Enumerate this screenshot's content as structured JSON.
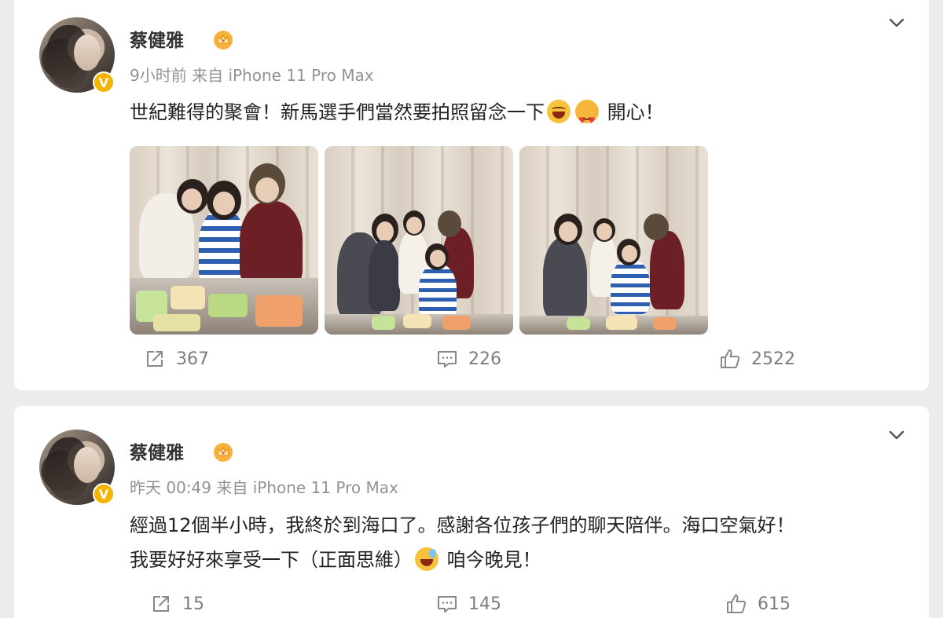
{
  "posts": [
    {
      "username": "蔡健雅",
      "meta": "9小时前  来自 iPhone 11 Pro Max",
      "text_before": "世紀難得的聚會！新馬選手們當然要拍照留念一下",
      "text_after": "開心！",
      "emojis": [
        "laughing-tears-emoji",
        "heart-eyes-emoji"
      ],
      "photos": [
        "group-photo-1",
        "group-photo-2",
        "group-photo-3"
      ],
      "repost_count": "367",
      "comment_count": "226",
      "like_count": "2522"
    },
    {
      "username": "蔡健雅",
      "meta": "昨天 00:49  来自 iPhone 11 Pro Max",
      "text_line1": "經過12個半小時，我終於到海口了。感謝各位孩子們的聊天陪伴。海口空氣好！",
      "text_line2_before": "我要好好來享受一下（正面思維）",
      "text_line2_after": "咱今晚見！",
      "emojis": [
        "sweat-smile-emoji"
      ],
      "repost_count": "15",
      "comment_count": "145",
      "like_count": "615"
    }
  ],
  "colors": {
    "background": "#ececec",
    "card": "#ffffff",
    "meta_text": "#939393",
    "verified_badge": "#f5b400",
    "action_text": "#7d7d7d"
  },
  "icons": [
    "chevron-down-icon",
    "crown-icon",
    "verified-icon",
    "repost-icon",
    "comment-icon",
    "like-icon"
  ]
}
